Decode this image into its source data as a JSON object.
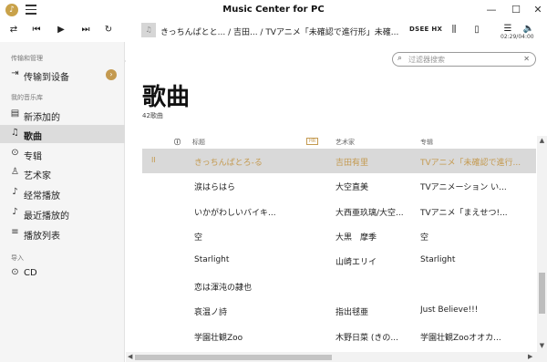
{
  "window": {
    "title": "Music Center for PC",
    "logo_glyph": "♪",
    "minimize_glyph": "—",
    "maximize_glyph": "☐",
    "close_glyph": "✕"
  },
  "player": {
    "now_playing": "きっちんぱとと... / 吉田... / TVアニメ「未確認で進行形」未確...",
    "dsee_label": "DSEE HX",
    "time": "02:29/04:00"
  },
  "sidebar": {
    "transfer_header": "传输和管理",
    "transfer_item": "传输到设备",
    "library_header": "我的音乐库",
    "items": [
      {
        "label": "新添加的",
        "icon": "new-added-icon",
        "glyph": "▤"
      },
      {
        "label": "歌曲",
        "icon": "music-note-icon",
        "glyph": "♫"
      },
      {
        "label": "专辑",
        "icon": "album-disc-icon",
        "glyph": "⊙"
      },
      {
        "label": "艺术家",
        "icon": "artist-icon",
        "glyph": "♙"
      },
      {
        "label": "经常播放",
        "icon": "frequently-played-icon",
        "glyph": "♪"
      },
      {
        "label": "最近播放的",
        "icon": "recently-played-icon",
        "glyph": "♪"
      },
      {
        "label": "播放列表",
        "icon": "playlist-icon",
        "glyph": "≡"
      }
    ],
    "import_header": "导入",
    "cd_item": "CD"
  },
  "main": {
    "search_placeholder": "过滤器搜索",
    "title": "歌曲",
    "song_count": "42歌曲",
    "columns": {
      "title": "标题",
      "hires": "HR",
      "artist": "艺术家",
      "album": "专辑"
    },
    "playing_indicator": "II"
  },
  "rows": [
    {
      "title": "きっちんぱとろ-る",
      "artist": "吉田有里",
      "album": "TVアニメ「未確認で進行..."
    },
    {
      "title": "涙はらはら",
      "artist": "大空直美",
      "album": "TVアニメーション い..."
    },
    {
      "title": "いかがわしいバイキ...",
      "artist": "大西亜玖璃/大空...",
      "album": "TVアニメ「まえせつ!..."
    },
    {
      "title": "空",
      "artist": "大黒　摩季",
      "album": "空"
    },
    {
      "title": "Starlight",
      "artist": "山崎エリイ",
      "album": "Starlight"
    },
    {
      "title": "恋は渾沌の隷也",
      "artist": "",
      "album": ""
    },
    {
      "title": "哀温ノ詩",
      "artist": "指出毬亜",
      "album": "Just Believe!!!"
    },
    {
      "title": "学園壮観Zoo",
      "artist": "木野日菜 (きの...",
      "album": "学園壮観Zooオオカ..."
    }
  ]
}
